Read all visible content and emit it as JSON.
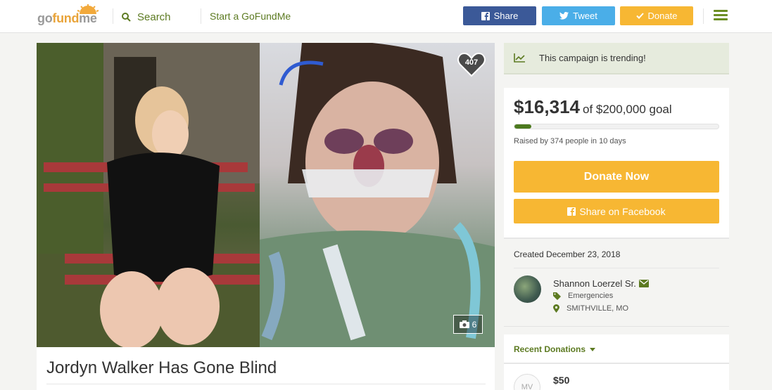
{
  "header": {
    "logo_prefix": "go",
    "logo_fund": "fund",
    "logo_suffix": "me",
    "search_label": "Search",
    "start_label": "Start a GoFundMe",
    "share_label": "Share",
    "tweet_label": "Tweet",
    "donate_label": "Donate"
  },
  "campaign": {
    "title": "Jordyn Walker Has Gone Blind",
    "hearts": "407",
    "photo_count": "6"
  },
  "trending": {
    "text": "This campaign is trending!"
  },
  "funding": {
    "raised": "$16,314",
    "goal_text": "of $200,000 goal",
    "progress_percent": 8.2,
    "raised_by": "Raised by 374 people in 10 days",
    "donate_now": "Donate Now",
    "share_facebook": "Share on Facebook"
  },
  "meta": {
    "created": "Created December 23, 2018",
    "organizer": "Shannon Loerzel Sr.",
    "category": "Emergencies",
    "location": "SMITHVILLE, MO"
  },
  "recent": {
    "label": "Recent Donations",
    "donations": [
      {
        "initials": "MV",
        "amount": "$50"
      }
    ]
  },
  "colors": {
    "brand_green": "#5c7a21",
    "brand_orange": "#f7b733",
    "facebook": "#3b5998",
    "twitter": "#4aaee8"
  }
}
